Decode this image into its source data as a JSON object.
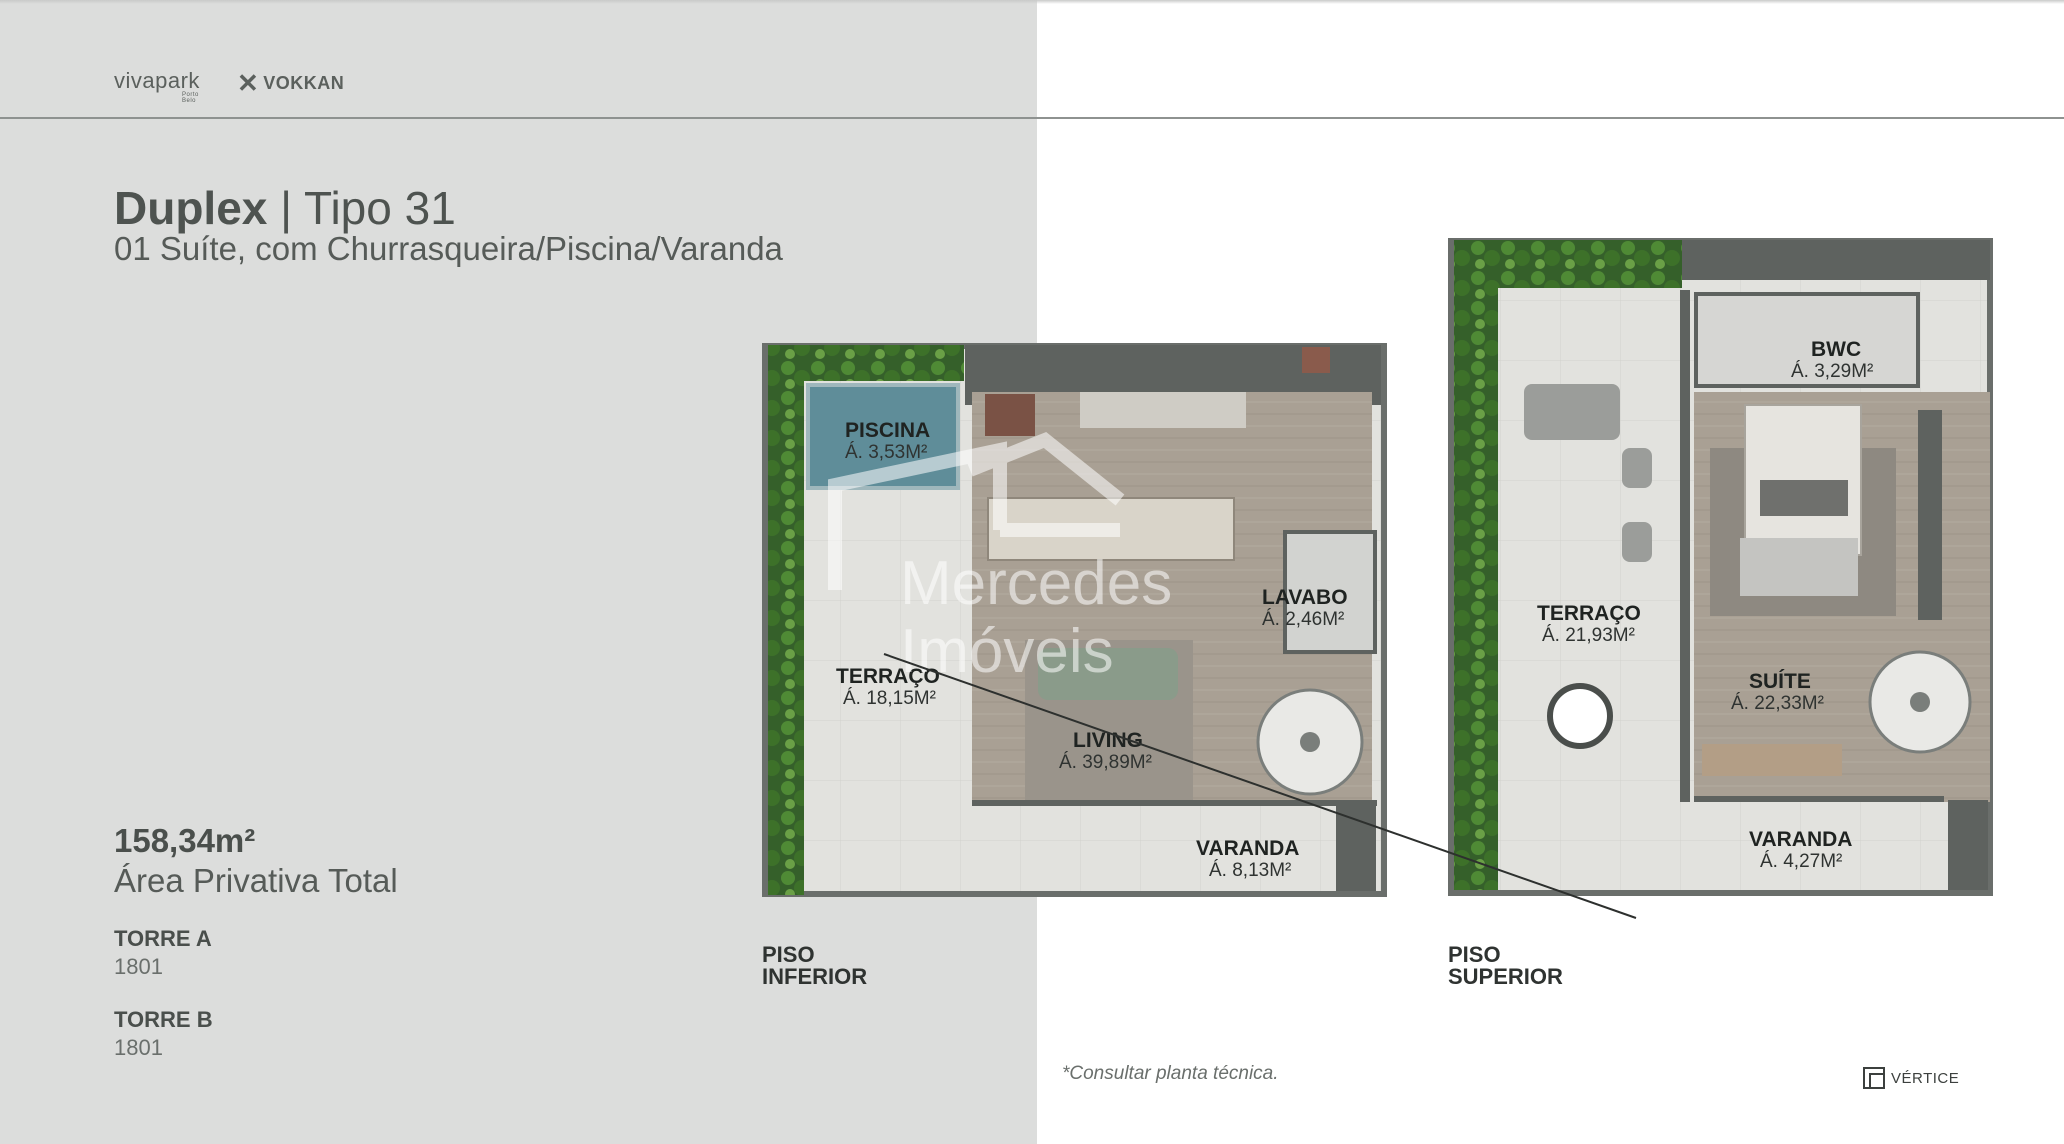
{
  "brands": {
    "vivapark": "vivapark",
    "vivapark_sub": "Porto Belo",
    "vokkan": "VOKKAN",
    "vokkan_mark": "✕"
  },
  "heading": {
    "title_bold": "Duplex",
    "title_rest": " | Tipo 31",
    "subtitle": "01 Suíte, com Churrasqueira/Piscina/Varanda"
  },
  "summary": {
    "area_value": "158,34m²",
    "area_label": "Área Privativa Total"
  },
  "towers": [
    {
      "name": "TORRE A",
      "unit": "1801"
    },
    {
      "name": "TORRE B",
      "unit": "1801"
    }
  ],
  "plans": {
    "lower": {
      "label_line1": "PISO",
      "label_line2": "INFERIOR",
      "rooms": {
        "piscina": {
          "name": "PISCINA",
          "area": "Á. 3,53M²"
        },
        "lavabo": {
          "name": "LAVABO",
          "area": "Á. 2,46M²"
        },
        "terraco": {
          "name": "TERRAÇO",
          "area": "Á. 18,15M²"
        },
        "living": {
          "name": "LIVING",
          "area": "Á. 39,89M²"
        },
        "varanda": {
          "name": "VARANDA",
          "area": "Á. 8,13M²"
        }
      }
    },
    "upper": {
      "label_line1": "PISO",
      "label_line2": "SUPERIOR",
      "rooms": {
        "bwc": {
          "name": "BWC",
          "area": "Á. 3,29M²"
        },
        "terraco": {
          "name": "TERRAÇO",
          "area": "Á. 21,93M²"
        },
        "suite": {
          "name": "SUÍTE",
          "area": "Á. 22,33M²"
        },
        "varanda": {
          "name": "VARANDA",
          "area": "Á. 4,27M²"
        }
      }
    }
  },
  "watermark": {
    "line1": "Mercedes",
    "line2": "Imóveis"
  },
  "footnote": "*Consultar planta técnica.",
  "credit": {
    "name": "VÉRTICE"
  },
  "colors": {
    "left_panel": "#dcdddc",
    "plan_wall": "#5e625f",
    "plan_floor_wood": "#a9a094",
    "plan_floor_tile": "#dfdfdb",
    "plan_green": "#3f6a2e",
    "pool": "#5f8d99"
  }
}
